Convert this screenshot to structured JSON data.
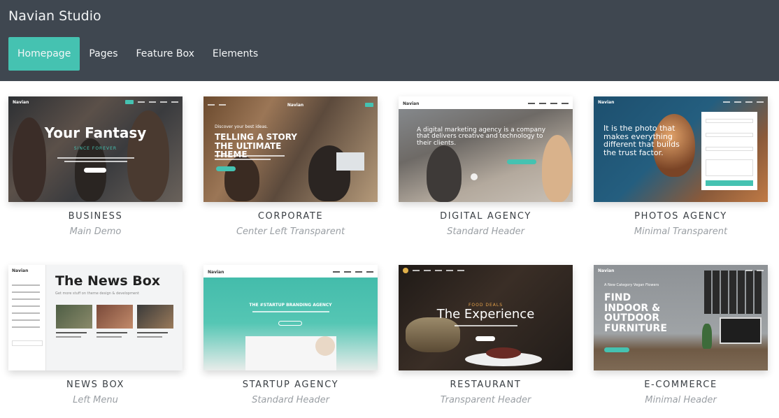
{
  "app": {
    "title": "Navian Studio"
  },
  "nav": {
    "items": [
      {
        "label": "Homepage",
        "active": true
      },
      {
        "label": "Pages",
        "active": false
      },
      {
        "label": "Feature Box",
        "active": false
      },
      {
        "label": "Elements",
        "active": false
      }
    ]
  },
  "colors": {
    "header_bg": "#3f4750",
    "accent": "#45c2b1"
  },
  "demos": [
    {
      "name": "BUSINESS",
      "subtitle": "Main Demo",
      "hero": "Your Fantasy",
      "tagline": "SINCE FOREVER",
      "logo": "Navian"
    },
    {
      "name": "CORPORATE",
      "subtitle": "Center Left Transparent",
      "hero": "TELLING A STORY THE ULTIMATE THEME",
      "tagline": "Discover your best ideas.",
      "logo": "Navian"
    },
    {
      "name": "DIGITAL AGENCY",
      "subtitle": "Standard Header",
      "hero": "A digital marketing agency is a company that delivers creative and technology to their clients.",
      "logo": "Navian"
    },
    {
      "name": "PHOTOS AGENCY",
      "subtitle": "Minimal Transparent",
      "hero": "It is the photo that makes everything different that builds the trust factor.",
      "logo": "Navian"
    },
    {
      "name": "NEWS BOX",
      "subtitle": "Left Menu",
      "hero": "The News Box",
      "tagline": "Get more stuff on theme design & development",
      "logo": "Navian"
    },
    {
      "name": "STARTUP AGENCY",
      "subtitle": "Standard Header",
      "hero": "THE #STARTUP BRANDING AGENCY",
      "logo": "Navian"
    },
    {
      "name": "RESTAURANT",
      "subtitle": "Transparent Header",
      "hero": "The Experience",
      "tagline": "FOOD DEALS",
      "logo": ""
    },
    {
      "name": "E-COMMERCE",
      "subtitle": "Minimal Header",
      "hero": "FIND INDOOR & OUTDOOR FURNITURE",
      "tagline": "A New Category Vegan Flowers",
      "logo": "Navian"
    }
  ]
}
